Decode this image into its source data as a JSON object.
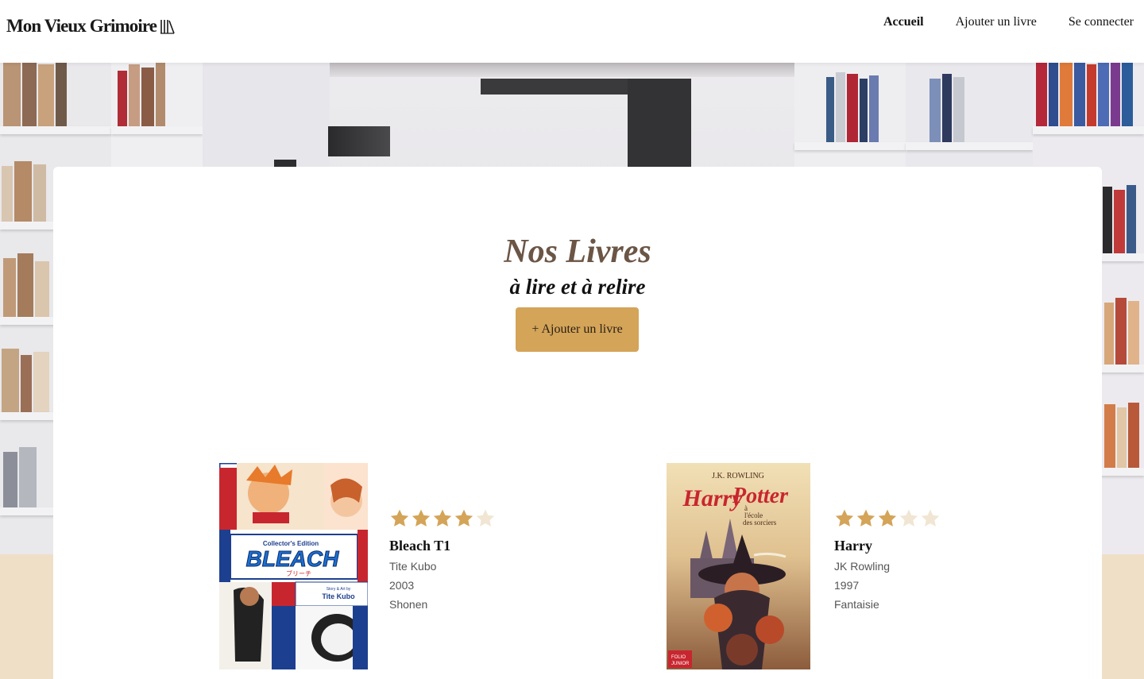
{
  "header": {
    "logo_text": "Mon Vieux Grimoire",
    "logo_icon": "books-icon",
    "nav": [
      {
        "label": "Accueil",
        "active": true
      },
      {
        "label": "Ajouter un livre",
        "active": false
      },
      {
        "label": "Se connecter",
        "active": false
      }
    ]
  },
  "main": {
    "title": "Nos Livres",
    "subtitle": "à lire et à relire",
    "add_button_label": "+ Ajouter un livre",
    "books": [
      {
        "title": "Bleach T1",
        "author": "Tite Kubo",
        "year": "2003",
        "genre": "Shonen",
        "rating": 4,
        "max_rating": 5
      },
      {
        "title": "Harry",
        "author": "JK Rowling",
        "year": "1997",
        "genre": "Fantaisie",
        "rating": 3,
        "max_rating": 5
      }
    ],
    "covers": {
      "bleach": {
        "edition": "Collector's Edition",
        "logo": "BLEACH",
        "kana": "ブリーチ",
        "credit_small": "Story & Art by",
        "credit": "Tite Kubo"
      },
      "harry": {
        "author": "J.K. ROWLING",
        "line1": "Harry",
        "line2": "Potter",
        "sub1": "à",
        "sub2": "l'école",
        "sub3": "des sorciers",
        "publisher1": "FOLIO",
        "publisher2": "JUNIOR"
      }
    }
  },
  "colors": {
    "accent": "#d4a459",
    "title": "#6b5545",
    "star_filled": "#d4a459",
    "star_empty": "#f1e6d3",
    "page_beige": "#efdfc6"
  }
}
